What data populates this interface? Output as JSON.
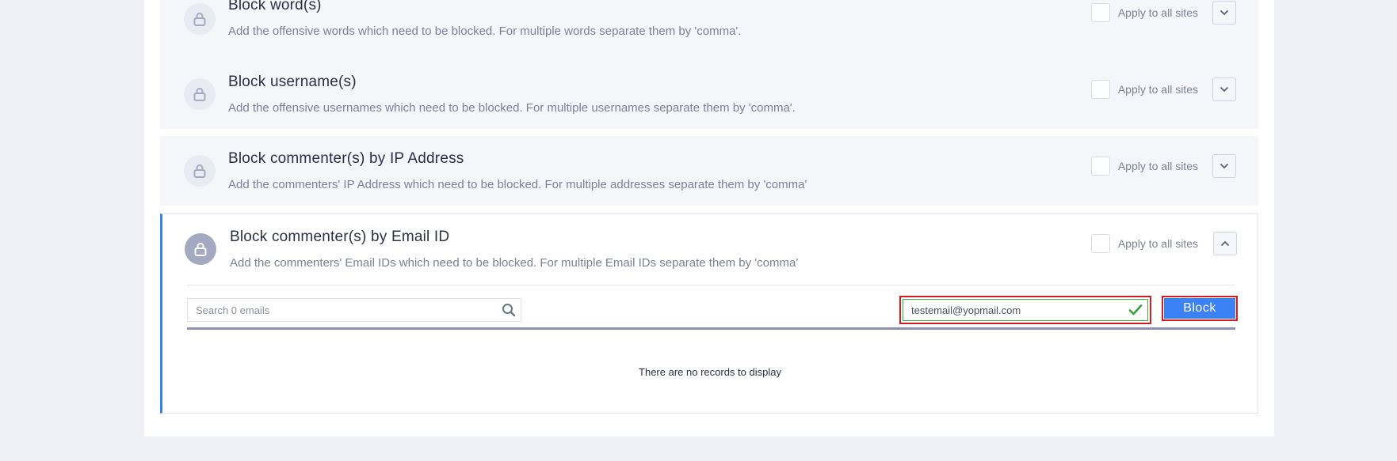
{
  "sections": [
    {
      "title": "Block word(s)",
      "description": "Add the offensive words which need to be blocked. For multiple words separate them by 'comma'.",
      "apply_label": "Apply to all sites",
      "expanded": false
    },
    {
      "title": "Block username(s)",
      "description": "Add the offensive usernames which need to be blocked. For multiple usernames separate them by 'comma'.",
      "apply_label": "Apply to all sites",
      "expanded": false
    },
    {
      "title": "Block commenter(s) by IP Address",
      "description": "Add the commenters' IP Address which need to be blocked. For multiple addresses separate them by 'comma'",
      "apply_label": "Apply to all sites",
      "expanded": false
    },
    {
      "title": "Block commenter(s) by Email ID",
      "description": "Add the commenters' Email IDs which need to be blocked. For multiple Email IDs separate them by 'comma'",
      "apply_label": "Apply to all sites",
      "expanded": true
    }
  ],
  "email_panel": {
    "search_placeholder": "Search 0 emails",
    "email_value": "testemail@yopmail.com",
    "block_label": "Block",
    "empty_message": "There are no records to display"
  },
  "icons": {
    "section": "lock-icon",
    "collapsed_toggle": "chevron-down-icon",
    "expanded_toggle": "chevron-up-icon",
    "search": "search-icon",
    "valid": "check-icon"
  },
  "colors": {
    "accent_blue": "#3b82f6",
    "highlight_red": "#d11e1e",
    "valid_green": "#3cb043"
  }
}
